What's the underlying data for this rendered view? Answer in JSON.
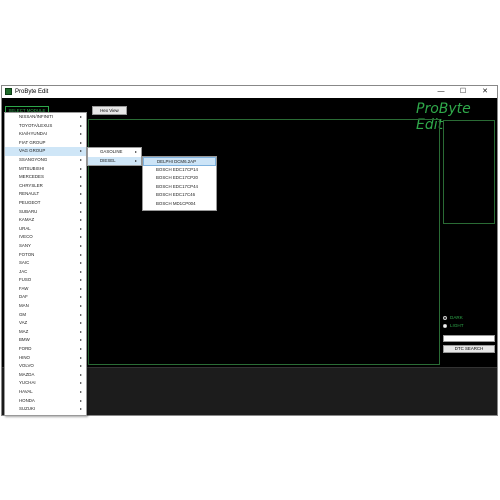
{
  "window": {
    "title": "ProByte Edit",
    "controls": {
      "minimize": "—",
      "maximize": "☐",
      "close": "✕"
    }
  },
  "toolbar": {
    "select_module": "SELECT MODULE",
    "hex_view": "Hex View"
  },
  "logo": "ProByte Edit",
  "theme": {
    "dark_label": "DARK",
    "light_label": "LIGHT",
    "selected": "DARK"
  },
  "dtc": {
    "input_value": "",
    "button": "DTC SEARCH"
  },
  "menu": {
    "items": [
      "NISSAN/INFINITI",
      "TOYOTA/LEXUS",
      "KIA/HYUNDAI",
      "FIAT GROUP",
      "VAG GROUP",
      "SSANGYONG",
      "MITSUBISHI",
      "MERCEDES",
      "CHRYSLER",
      "RENAULT",
      "PEUGEOT",
      "SUBARU",
      "KAMAZ",
      "URAL",
      "IVECO",
      "SANY",
      "FOTON",
      "SAIC",
      "JAC",
      "FUSO",
      "FAW",
      "DAF",
      "MAN",
      "GM",
      "VAZ",
      "MAZ",
      "BMW",
      "FORD",
      "HINO",
      "VOLVO",
      "MAZDA",
      "YUCHAI",
      "HAVAL",
      "HONDA",
      "SUZUKI"
    ],
    "highlighted": "VAG GROUP"
  },
  "submenu": {
    "items": [
      "GASOLINE",
      "DIESEL"
    ],
    "highlighted": "DIESEL"
  },
  "submenu2": {
    "items": [
      "DELPHI DCM6.2AP",
      "BOSCH EDC17CP14",
      "BOSCH EDC17CP20",
      "BOSCH EDC17CP44",
      "BOSCH EDC17C46",
      "BOSCH MD1CP004"
    ],
    "highlighted": "DELPHI DCM6.2AP"
  },
  "colors": {
    "accent": "#2ea84a",
    "background": "#000000",
    "panel_border": "#2a6b35"
  }
}
